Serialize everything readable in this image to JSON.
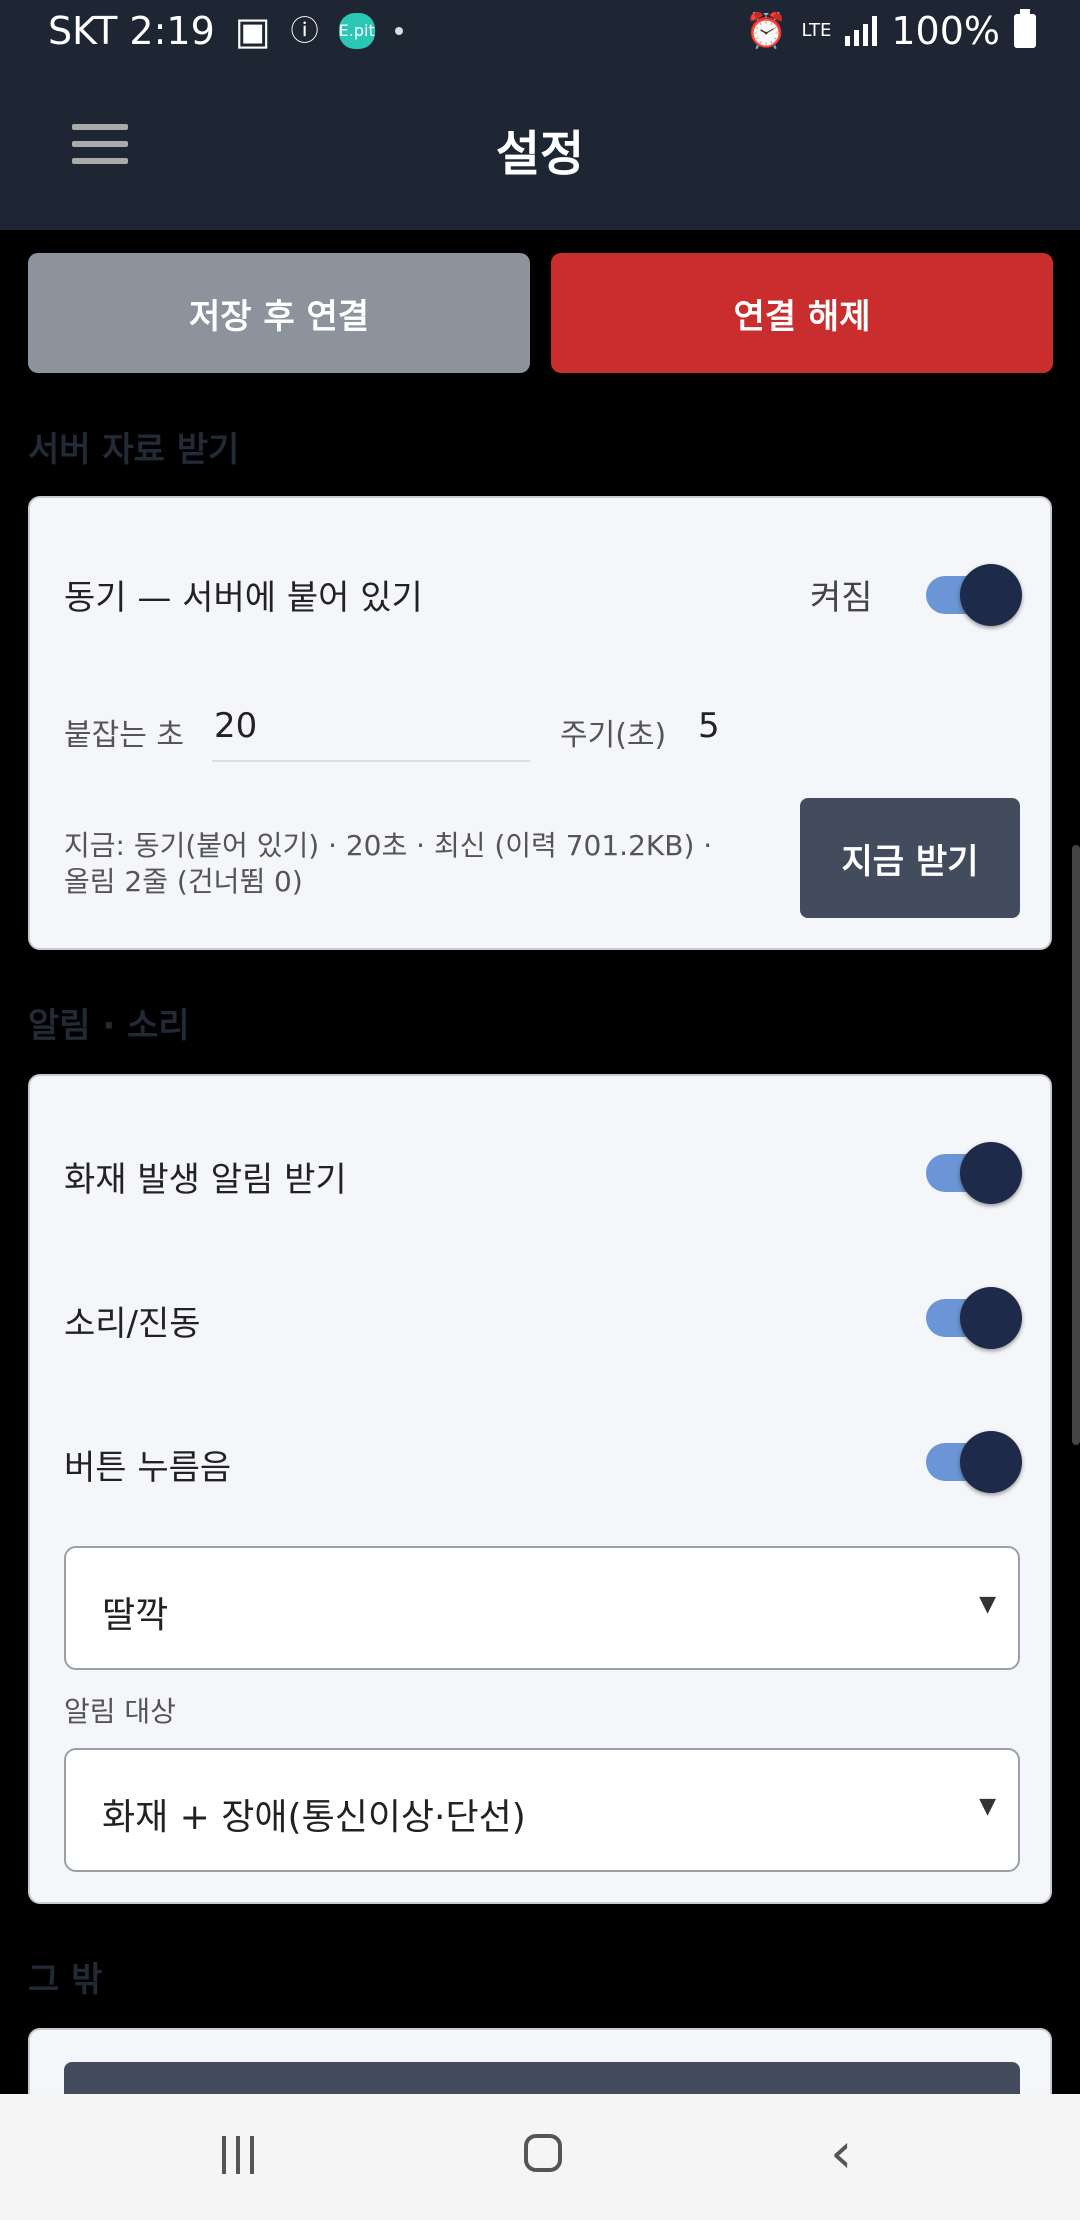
{
  "status_bar": {
    "carrier": "SKT",
    "time": "2:19",
    "app_badge": "E.pit",
    "network": "LTE",
    "battery": "100%"
  },
  "header": {
    "title": "설정"
  },
  "actions": {
    "save_connect": "저장 후 연결",
    "disconnect": "연결 해제"
  },
  "sections": {
    "server": "서버 자료 받기",
    "alerts": "알림 · 소리",
    "other": "그 밖"
  },
  "server_card": {
    "sync_label": "동기 — 서버에 붙어 있기",
    "sync_state": "켜짐",
    "hold_seconds_label": "붙잡는 초",
    "hold_seconds_value": "20",
    "period_label": "주기(초)",
    "period_value": "5",
    "status_line1": "지금: 동기(붙어 있기) · 20초 · 최신 (이력 701.2KB) ·",
    "status_line2": "올림 2줄 (건너뜀 0)",
    "fetch_now": "지금 받기"
  },
  "alerts_card": {
    "fire_alert_label": "화재 발생 알림 받기",
    "sound_vibe_label": "소리/진동",
    "button_sound_label": "버튼 누름음",
    "button_sound_select": "딸깍",
    "alert_target_label": "알림 대상",
    "alert_target_select": "화재 + 장애(통신이상·단선)"
  },
  "toggles": {
    "sync": true,
    "fire_alert": true,
    "sound_vibe": true,
    "button_sound": true
  },
  "colors": {
    "appbar": "#1e2533",
    "disconnect": "#c92d2d",
    "save": "#8c939c",
    "toggle_knob": "#1e2a4a",
    "toggle_track": "#6b95d6"
  }
}
